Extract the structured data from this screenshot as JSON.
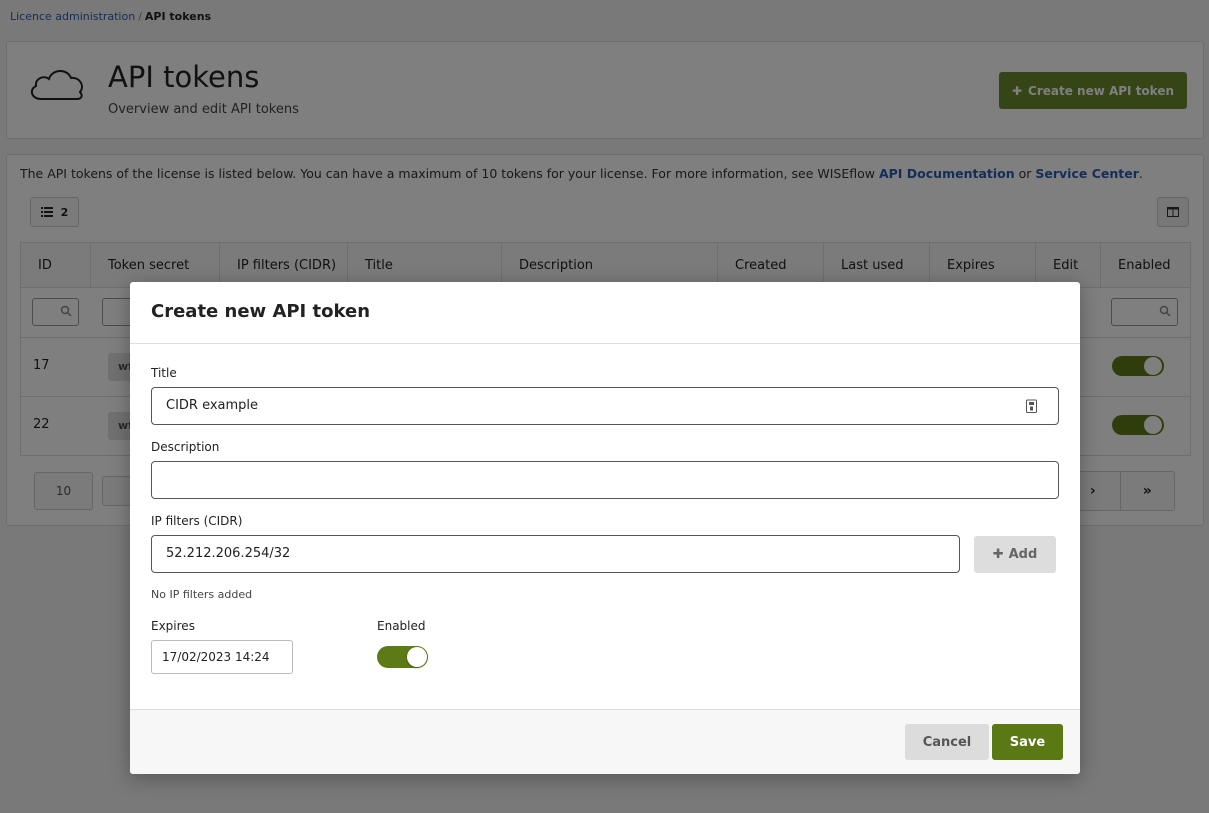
{
  "breadcrumb": {
    "parent": "Licence administration",
    "separator": "/",
    "current": "API tokens"
  },
  "header": {
    "title": "API tokens",
    "subtitle": "Overview and edit API tokens",
    "create_button": "Create new API token",
    "icon": "cloud-icon"
  },
  "content": {
    "info_prefix": "The API tokens of the license is listed below. You can have a maximum of 10 tokens for your license. For more information, see WISEflow ",
    "info_link1": "API Documentation",
    "info_mid": " or ",
    "info_link2": "Service Center",
    "info_suffix": ".",
    "list_count": "2"
  },
  "table": {
    "columns": [
      "ID",
      "Token secret",
      "IP filters (CIDR)",
      "Title",
      "Description",
      "Created",
      "Last used",
      "Expires",
      "Edit",
      "Enabled"
    ],
    "rows": [
      {
        "id": "17",
        "secret": "wf",
        "enabled": true
      },
      {
        "id": "22",
        "secret": "wf",
        "enabled": true
      }
    ]
  },
  "pager": {
    "page_size": "10",
    "next": "›",
    "last": "»"
  },
  "modal": {
    "title": "Create new API token",
    "title_label": "Title",
    "title_value": "CIDR example",
    "description_label": "Description",
    "description_value": "",
    "ip_label": "IP filters (CIDR)",
    "ip_value": "52.212.206.254/32",
    "add_button": "Add",
    "no_filters_hint": "No IP filters added",
    "expires_label": "Expires",
    "expires_value": "17/02/2023 14:24",
    "enabled_label": "Enabled",
    "enabled": true,
    "cancel_button": "Cancel",
    "save_button": "Save"
  },
  "colors": {
    "accent": "#5a7814",
    "link": "#2a5db0"
  }
}
